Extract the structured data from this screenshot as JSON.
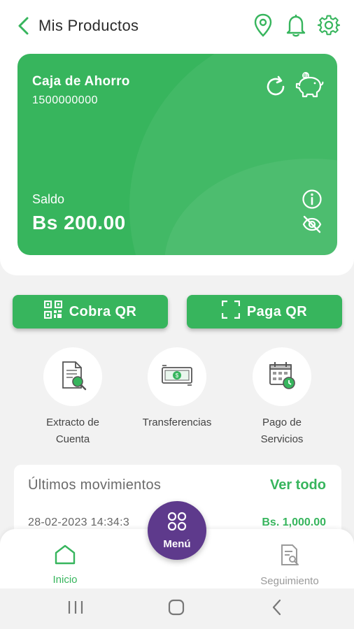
{
  "header": {
    "title": "Mis Productos",
    "icons": [
      "back-arrow-icon",
      "location-pin-icon",
      "bell-icon",
      "gear-icon"
    ]
  },
  "account_card": {
    "name": "Caja de Ahorro",
    "number": "1500000000",
    "balance_label": "Saldo",
    "balance_value": "Bs 200.00",
    "icons": [
      "refresh-icon",
      "piggy-bank-icon",
      "info-icon",
      "eye-off-icon"
    ]
  },
  "qr_actions": {
    "cobra_label": "Cobra QR",
    "paga_label": "Paga QR"
  },
  "quick_actions": [
    {
      "label": "Extracto de\nCuenta",
      "icon": "account-statement-icon"
    },
    {
      "label": "Transferencias",
      "icon": "money-transfer-icon"
    },
    {
      "label": "Pago de\nServicios",
      "icon": "calendar-payment-icon"
    }
  ],
  "movements": {
    "title": "Últimos movimientos",
    "see_all": "Ver todo",
    "items": [
      {
        "date": "28-02-2023 14:34:3",
        "amount": "Bs. 1,000.00"
      }
    ]
  },
  "bottom_nav": {
    "home_label": "Inicio",
    "menu_label": "Menú",
    "tracking_label": "Seguimiento"
  },
  "colors": {
    "primary_green": "#37b55d",
    "menu_purple": "#5e3a8c",
    "background": "#f2f2f2"
  }
}
